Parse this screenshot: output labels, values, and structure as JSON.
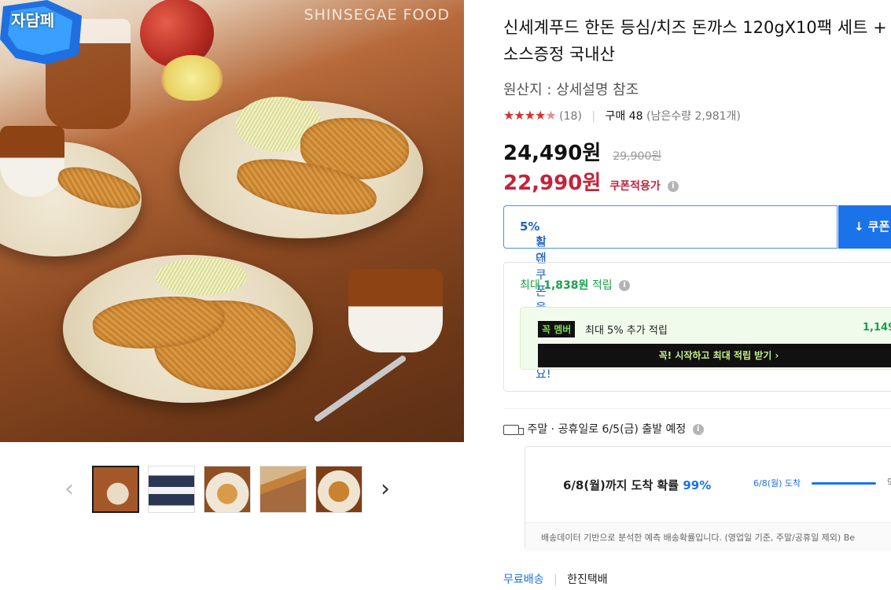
{
  "gallery": {
    "brand_text": "SHINSEGAE FOOD",
    "badge_text": "자담페",
    "prev_arrow": "‹",
    "next_arrow": "›",
    "thumbnails": [
      "thumbnail-1",
      "thumbnail-2",
      "thumbnail-3",
      "thumbnail-4",
      "thumbnail-5"
    ],
    "selected_index": 0
  },
  "product": {
    "title": "신세계푸드 한돈 등심/치즈 돈까스 120gX10팩 세트 + 소스증정 국내산",
    "origin": "원산지 : 상세설명 참조",
    "rating_stars": 4.5,
    "review_count": "(18)",
    "purchase": "구매 48",
    "stock": "(남은수량 2,981개)"
  },
  "price": {
    "sale": "24,490원",
    "original": "29,900원",
    "coupon_price": "22,990원",
    "coupon_label": "쿠폰적용가"
  },
  "coupon": {
    "text_prefix": "최대 ",
    "text_bold": "5%",
    "text_suffix": " 할인 쿠폰을 받으세요!",
    "button_label": "↓ 쿠폰"
  },
  "reward": {
    "prefix": "최대 ",
    "amount": "1,838원",
    "suffix": " 적립",
    "member_tag": "꼭 멤버",
    "member_text": "최대 5% 추가 적립",
    "member_amount": "1,149",
    "member_cta": "꼭! 시작하고 최대 적립 받기 ›"
  },
  "delivery": {
    "ship_text": "주말 · 공휴일로 6/5(금) 출발 예정",
    "arrival_prefix": "6/8(월)까지 도착 확률 ",
    "arrival_pct": "99%",
    "arrival_small": "6/8(월) 도착",
    "arrival_tail": "9",
    "footnote": "배송데이터 기반으로 분석한 예측 배송확률입니다. (영업일 기준, 주말/공휴일 제외) Be",
    "free_shipping": "무료배송",
    "carrier": "한진택배"
  },
  "colors": {
    "sale_red": "#c3243a",
    "accent_blue": "#1a73e8",
    "reward_green": "#1aa04a",
    "star_red": "#d63131"
  }
}
